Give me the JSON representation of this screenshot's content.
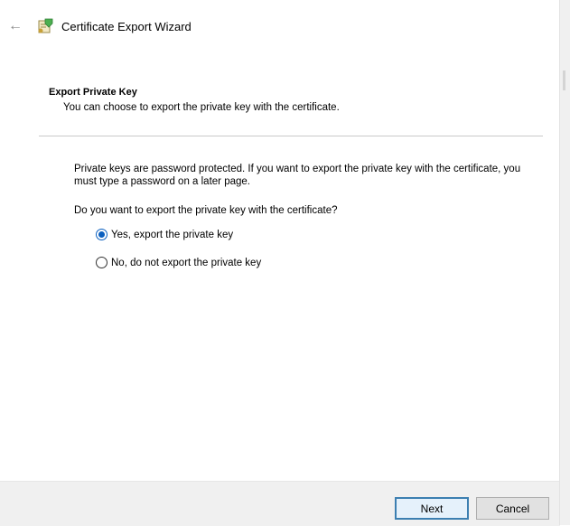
{
  "window": {
    "title": "Certificate Export Wizard",
    "back_icon": "back-arrow-icon",
    "app_icon": "certificate-icon"
  },
  "header": {
    "title": "Export Private Key",
    "subtitle": "You can choose to export the private key with the certificate."
  },
  "body": {
    "description": "Private keys are password protected. If you want to export the private key with the certificate, you must type a password on a later page.",
    "question": "Do you want to export the private key with the certificate?",
    "options": [
      {
        "label": "Yes, export the private key",
        "selected": true
      },
      {
        "label": "No, do not export the private key",
        "selected": false
      }
    ]
  },
  "footer": {
    "next_label": "Next",
    "cancel_label": "Cancel"
  },
  "colors": {
    "accent": "#0a5fbf",
    "footer_bg": "#f0f0f0",
    "default_button_border": "#3c7fb1"
  }
}
